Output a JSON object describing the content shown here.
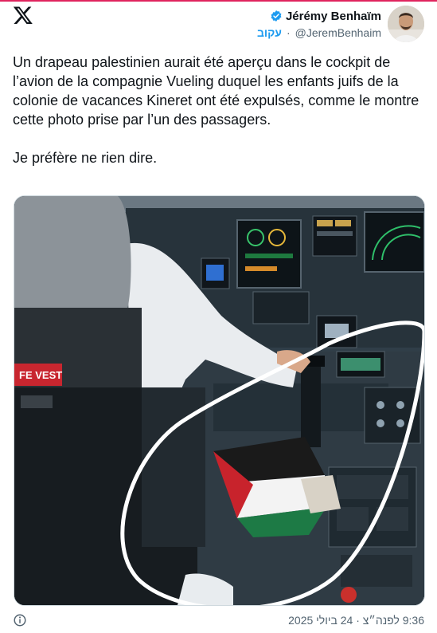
{
  "colors": {
    "accent": "#1d9bf0",
    "text": "#0f1419",
    "secondary_text": "#536471",
    "top_border": "#e0245e"
  },
  "header": {
    "logo_icon": "x-logo-icon",
    "display_name": "Jérémy Benhaïm",
    "verified_icon": "verified-badge-icon",
    "handle": "@JeremBenhaim",
    "separator": "·",
    "follow_label": "עקוב"
  },
  "tweet": {
    "text": "Un drapeau palestinien aurait été aperçu dans le cockpit de l’avion de la compagnie Vueling duquel les enfants juifs de la colonie de vacances Kineret ont été expulsés, comme le montre cette photo prise par l’un des passagers.",
    "text2": "Je préfère ne rien dire."
  },
  "media": {
    "placard_text": "FE VEST"
  },
  "footer": {
    "info_icon": "info-icon",
    "timestamp": "9:36 לפנה״צ · 24 ביולי 2025"
  }
}
